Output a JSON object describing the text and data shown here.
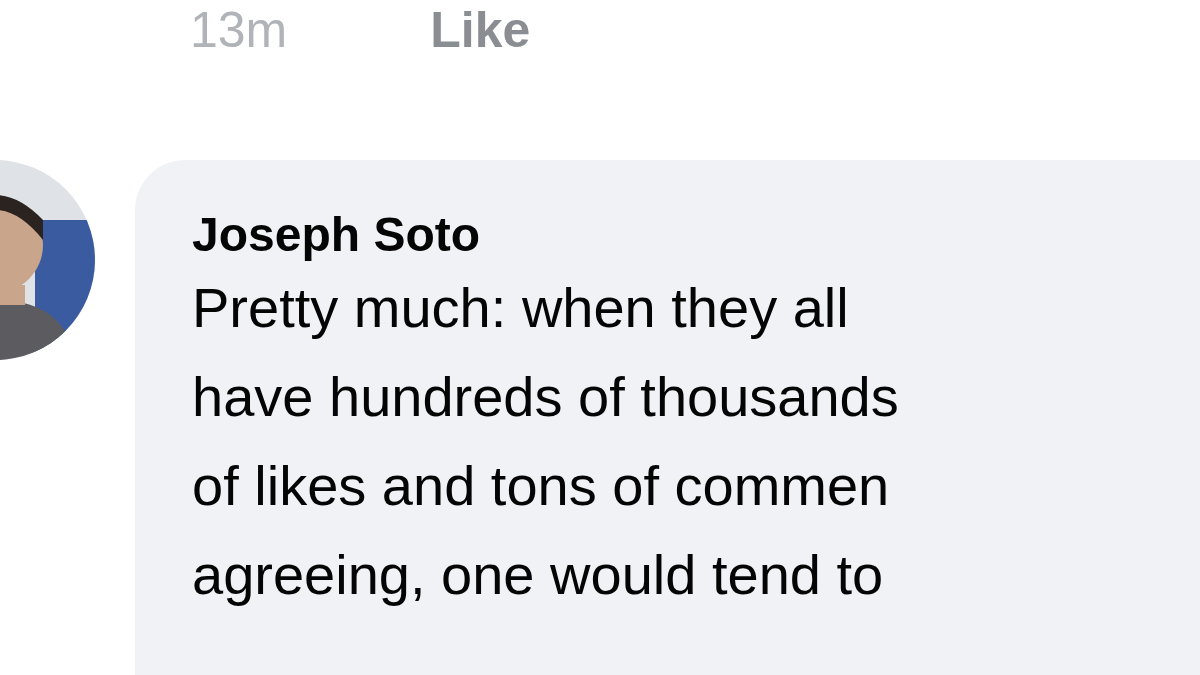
{
  "previous_comment": {
    "time": "13m",
    "like_label": "Like"
  },
  "comment": {
    "author": "Joseph Soto",
    "lines": [
      "Pretty much: when they all",
      "have hundreds of thousands",
      "of likes and tons of commen",
      "agreeing, one would tend to"
    ]
  }
}
